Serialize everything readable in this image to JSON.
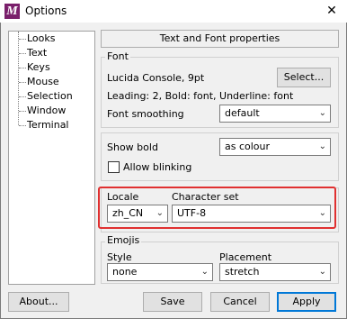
{
  "window": {
    "title": "Options",
    "app_icon_letter": "M",
    "close_glyph": "✕"
  },
  "tree": {
    "items": [
      "Looks",
      "Text",
      "Keys",
      "Mouse",
      "Selection",
      "Window",
      "Terminal"
    ]
  },
  "header": {
    "label": "Text and Font properties"
  },
  "font_group": {
    "legend": "Font",
    "font_name": "Lucida Console, 9pt",
    "select_button": "Select...",
    "details": "Leading: 2, Bold: font, Underline: font",
    "smoothing_label": "Font smoothing",
    "smoothing_value": "default"
  },
  "bold_group": {
    "show_bold_label": "Show bold",
    "show_bold_value": "as colour",
    "allow_blinking_label": "Allow blinking",
    "allow_blinking_checked": false
  },
  "locale_group": {
    "locale_label": "Locale",
    "locale_value": "zh_CN",
    "charset_label": "Character set",
    "charset_value": "UTF-8",
    "highlight_color": "#e03030"
  },
  "emojis_group": {
    "legend": "Emojis",
    "style_label": "Style",
    "style_value": "none",
    "placement_label": "Placement",
    "placement_value": "stretch"
  },
  "footer": {
    "about": "About...",
    "save": "Save",
    "cancel": "Cancel",
    "apply": "Apply"
  }
}
